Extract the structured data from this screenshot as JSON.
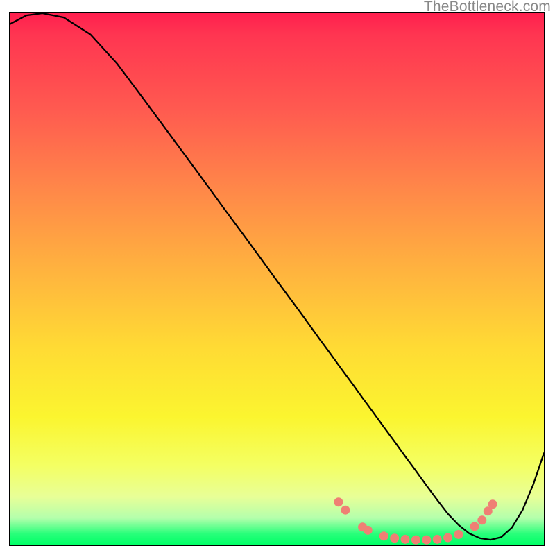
{
  "watermark": "TheBottleneck.com",
  "chart_data": {
    "type": "line",
    "title": "",
    "xlabel": "",
    "ylabel": "",
    "xlim": [
      0,
      100
    ],
    "ylim": [
      0,
      100
    ],
    "series": [
      {
        "name": "bottleneck-curve",
        "x": [
          0,
          3,
          6,
          10,
          15,
          20,
          25,
          30,
          35,
          40,
          45,
          50,
          55,
          58,
          60,
          62,
          64,
          66,
          68,
          70,
          72,
          74,
          76,
          78,
          80,
          82,
          84,
          86,
          88,
          90,
          92,
          94,
          96,
          98,
          100
        ],
        "y": [
          98,
          99.6,
          100,
          99.2,
          96.0,
          90.5,
          83.8,
          77.0,
          70.2,
          63.3,
          56.5,
          49.6,
          42.8,
          38.6,
          35.9,
          33.1,
          30.4,
          27.6,
          24.9,
          22.1,
          19.4,
          16.6,
          13.9,
          11.1,
          8.4,
          5.8,
          3.7,
          2.1,
          1.2,
          0.9,
          1.4,
          3.2,
          6.5,
          11.3,
          17.2
        ]
      }
    ],
    "highlight_points": {
      "name": "salmon-dots",
      "color": "#ef8074",
      "points": [
        {
          "x": 61.5,
          "y": 8.0
        },
        {
          "x": 62.8,
          "y": 6.5
        },
        {
          "x": 66.0,
          "y": 3.3
        },
        {
          "x": 67.0,
          "y": 2.7
        },
        {
          "x": 70.0,
          "y": 1.6
        },
        {
          "x": 72.0,
          "y": 1.2
        },
        {
          "x": 74.0,
          "y": 1.0
        },
        {
          "x": 76.0,
          "y": 0.9
        },
        {
          "x": 78.0,
          "y": 0.9
        },
        {
          "x": 80.0,
          "y": 1.0
        },
        {
          "x": 82.0,
          "y": 1.3
        },
        {
          "x": 84.0,
          "y": 1.9
        },
        {
          "x": 87.0,
          "y": 3.4
        },
        {
          "x": 88.4,
          "y": 4.6
        },
        {
          "x": 89.5,
          "y": 6.3
        },
        {
          "x": 90.4,
          "y": 7.6
        }
      ]
    },
    "gradient_stops": [
      {
        "pos": 0,
        "color": "#ff1f4e"
      },
      {
        "pos": 18,
        "color": "#ff5a50"
      },
      {
        "pos": 48,
        "color": "#ffb23f"
      },
      {
        "pos": 76,
        "color": "#fbf52f"
      },
      {
        "pos": 95,
        "color": "#b4ffac"
      },
      {
        "pos": 100,
        "color": "#00ff66"
      }
    ]
  }
}
